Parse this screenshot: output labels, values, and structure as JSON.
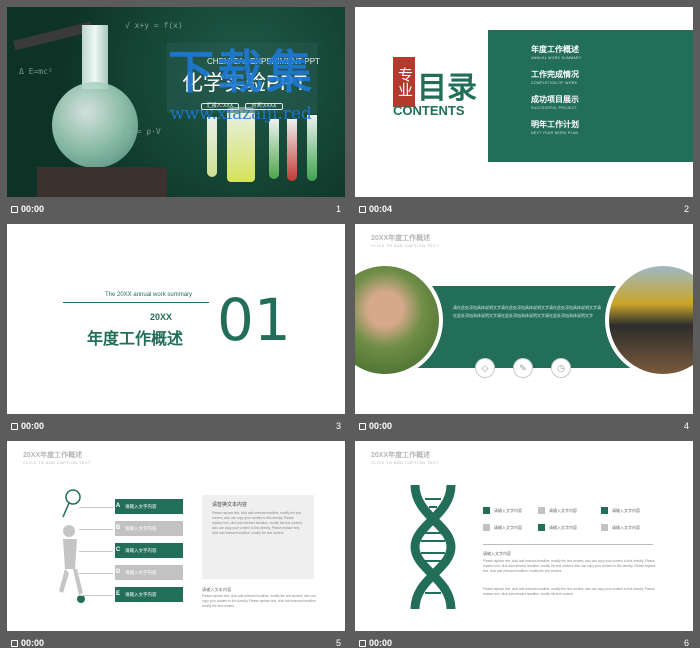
{
  "slides": [
    {
      "number": "1",
      "time": "00:00",
      "en_title": "CHEMICAL EXPERIMENT PPT",
      "cn_title": "化学实验PPT",
      "buttons": [
        "汇报人:XXX",
        "时间:XXXX"
      ],
      "watermark_cn": "下载集",
      "watermark_url": "www.xiazaiji.red"
    },
    {
      "number": "2",
      "time": "00:04",
      "seal": "专业",
      "title": "目录",
      "subtitle": "CONTENTS",
      "items": [
        {
          "cn": "年度工作概述",
          "en": "ANNUAL WORK SUMMARY"
        },
        {
          "cn": "工作完成情况",
          "en": "COMPLETION OF WORK"
        },
        {
          "cn": "成功项目展示",
          "en": "SUCCESSFUL PROJECT"
        },
        {
          "cn": "明年工作计划",
          "en": "NEXT YEAR WORK PLAN"
        }
      ]
    },
    {
      "number": "3",
      "time": "00:00",
      "summary": "The 20XX annual work summary",
      "year": "20XX",
      "title": "年度工作概述",
      "big_number": "01"
    },
    {
      "number": "4",
      "time": "00:00",
      "title": "20XX年度工作概述",
      "caption": "CLICK TO ADD CAPTION TEXT",
      "band_text": "请在此处添加具体说明文字请在此处添加具体说明文字请在此处添加具体说明文字请在此处添加具体说明文字请在此处添加具体说明文字请在此处添加具体说明文字"
    },
    {
      "number": "5",
      "time": "00:00",
      "title": "20XX年度工作概述",
      "caption": "CLICK TO ADD CAPTION TEXT",
      "tags": [
        {
          "letter": "A",
          "label": "请输入文字内容"
        },
        {
          "letter": "B",
          "label": "请输入文字内容"
        },
        {
          "letter": "C",
          "label": "请输入文字内容"
        },
        {
          "letter": "D",
          "label": "请输入文字内容"
        },
        {
          "letter": "E",
          "label": "请输入文字内容"
        }
      ],
      "box_title": "请替换文本内容",
      "box_text": "Please replace text, click add relevant headline, modify the text content, also can copy your content to this directly. Please replace text, click add relevant headline, modify the text content, also can copy your content to this directly. Please replace text, click add relevant headline, modify the text content.",
      "lower_title": "请输入文本内容",
      "lower_text": "Please replace text, click add relevant headline, modify the text content, also can copy your content to this directly. Please replace text, click add relevant headline, modify the text content."
    },
    {
      "number": "6",
      "time": "00:00",
      "title": "20XX年度工作概述",
      "caption": "CLICK TO ADD CAPTION TEXT",
      "legend": [
        "请输入文字内容",
        "请输入文字内容",
        "请输入文字内容",
        "请输入文字内容",
        "请输入文字内容",
        "请输入文字内容"
      ],
      "section_label": "请输入文字内容",
      "para1": "Please replace text, click add relevant headline, modify the text content, also can copy your content to this directly. Please replace text, click add relevant headline, modify the text content, also can copy your content to this directly. Please replace text, click add relevant headline, modify the text content.",
      "para2": "Please replace text, click add relevant headline, modify the text content, also can copy your content to this directly. Please replace text, click add relevant headline, modify the text content."
    }
  ],
  "colors": {
    "accent": "#226e59",
    "background": "#5c5c5c",
    "seal": "#b33a2c",
    "watermark": "#1e78d2"
  }
}
